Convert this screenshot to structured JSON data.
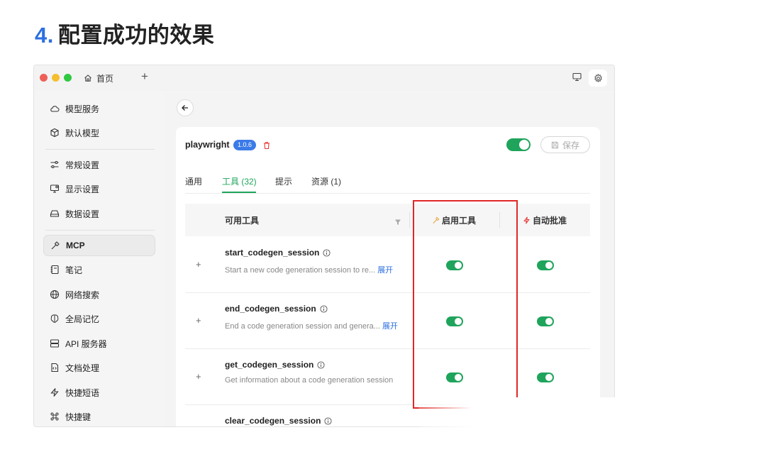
{
  "heading": {
    "number": "4.",
    "title": "配置成功的效果"
  },
  "titlebar": {
    "home_tab": "首页",
    "new_tab": "+"
  },
  "sidebar": {
    "items": [
      {
        "label": "模型服务",
        "icon": "cloud-icon"
      },
      {
        "label": "默认模型",
        "icon": "cube-icon"
      },
      {
        "label": "常规设置",
        "icon": "sliders-icon"
      },
      {
        "label": "显示设置",
        "icon": "display-icon"
      },
      {
        "label": "数据设置",
        "icon": "hard-drive-icon"
      },
      {
        "label": "MCP",
        "icon": "hammer-icon"
      },
      {
        "label": "笔记",
        "icon": "notebook-icon"
      },
      {
        "label": "网络搜索",
        "icon": "globe-icon"
      },
      {
        "label": "全局记忆",
        "icon": "brain-icon"
      },
      {
        "label": "API 服务器",
        "icon": "server-icon"
      },
      {
        "label": "文档处理",
        "icon": "file-code-icon"
      },
      {
        "label": "快捷短语",
        "icon": "zap-icon"
      },
      {
        "label": "快捷键",
        "icon": "command-icon"
      }
    ],
    "active_index": 5
  },
  "server": {
    "name": "playwright",
    "version": "1.0.6",
    "enabled": true,
    "save_label": "保存"
  },
  "tabs": [
    {
      "label": "通用",
      "active": false
    },
    {
      "label": "工具 (32)",
      "active": true
    },
    {
      "label": "提示",
      "active": false
    },
    {
      "label": "资源 (1)",
      "active": false
    }
  ],
  "table": {
    "headers": {
      "tool": "可用工具",
      "enable": "启用工具",
      "auto_approve": "自动批准"
    },
    "expand_label": "展开",
    "rows": [
      {
        "name": "start_codegen_session",
        "description": "Start a new code generation session to re...",
        "has_expand": true,
        "enabled": true,
        "auto_approve": true
      },
      {
        "name": "end_codegen_session",
        "description": "End a code generation session and genera...",
        "has_expand": true,
        "enabled": true,
        "auto_approve": true
      },
      {
        "name": "get_codegen_session",
        "description": "Get information about a code generation session",
        "has_expand": false,
        "enabled": true,
        "auto_approve": true
      },
      {
        "name": "clear_codegen_session",
        "description": "",
        "has_expand": false,
        "enabled": true,
        "auto_approve": true
      }
    ]
  },
  "colors": {
    "accent_green": "#1fa45c",
    "accent_blue": "#2d6fe0",
    "highlight_red": "#e02727"
  }
}
